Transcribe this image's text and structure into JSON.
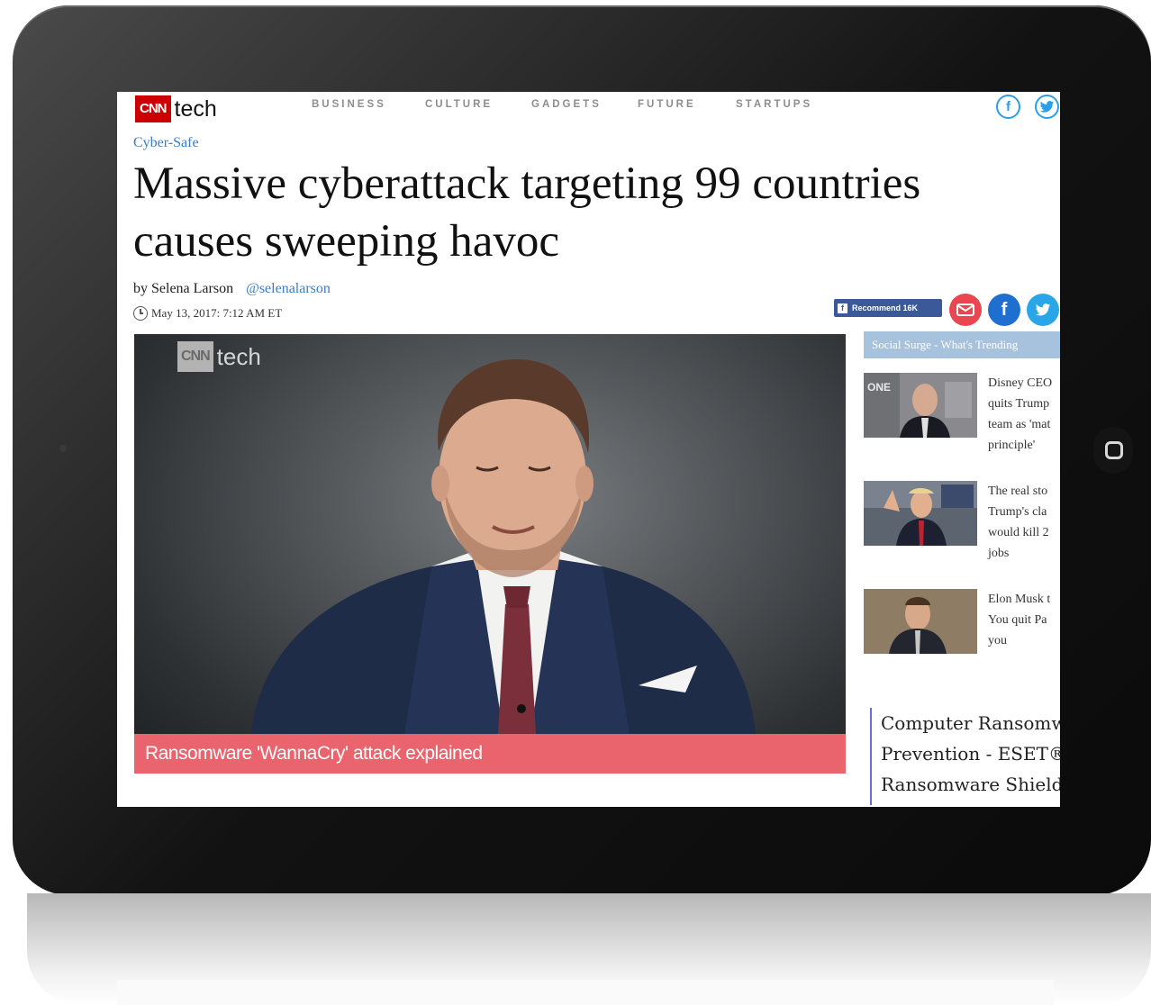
{
  "header": {
    "logo_cnn": "CNN",
    "logo_tech": "tech",
    "nav": [
      "BUSINESS",
      "CULTURE",
      "GADGETS",
      "FUTURE",
      "STARTUPS"
    ],
    "social_icons": [
      "facebook-icon",
      "twitter-icon"
    ]
  },
  "article": {
    "section": "Cyber-Safe",
    "headline_line1": "Massive cyberattack targeting 99 countries",
    "headline_line2": "causes sweeping havoc",
    "byline_prefix": "by Selena Larson",
    "byline_handle": "@selenalarson",
    "date": "May 13, 2017: 7:12 AM ET"
  },
  "share": {
    "recommend_label": "Recommend 16K",
    "icons": [
      "email-icon",
      "facebook-icon",
      "twitter-icon"
    ],
    "colors": {
      "facebook": "#3b5998",
      "email": "#e9464f",
      "fb_circle": "#1f6fd0",
      "twitter": "#2aa6e8"
    }
  },
  "video": {
    "logo_cnn": "CNN",
    "logo_tech": "tech",
    "caption": "Ransomware 'WannaCry' attack explained",
    "caption_color": "#e9646c"
  },
  "sidebar": {
    "heading": "Social Surge - What's Trending",
    "stories": [
      {
        "lines": [
          "Disney CEO",
          "quits Trump",
          "team as 'mat",
          "principle'"
        ]
      },
      {
        "lines": [
          "The real sto",
          "Trump's cla",
          "would kill 2",
          "jobs"
        ]
      },
      {
        "lines": [
          "Elon Musk t",
          "You quit Pa",
          "you"
        ]
      }
    ]
  },
  "ad": {
    "lines": [
      "Computer Ransomw",
      "Prevention - ESET®",
      "Ransomware Shield"
    ]
  }
}
